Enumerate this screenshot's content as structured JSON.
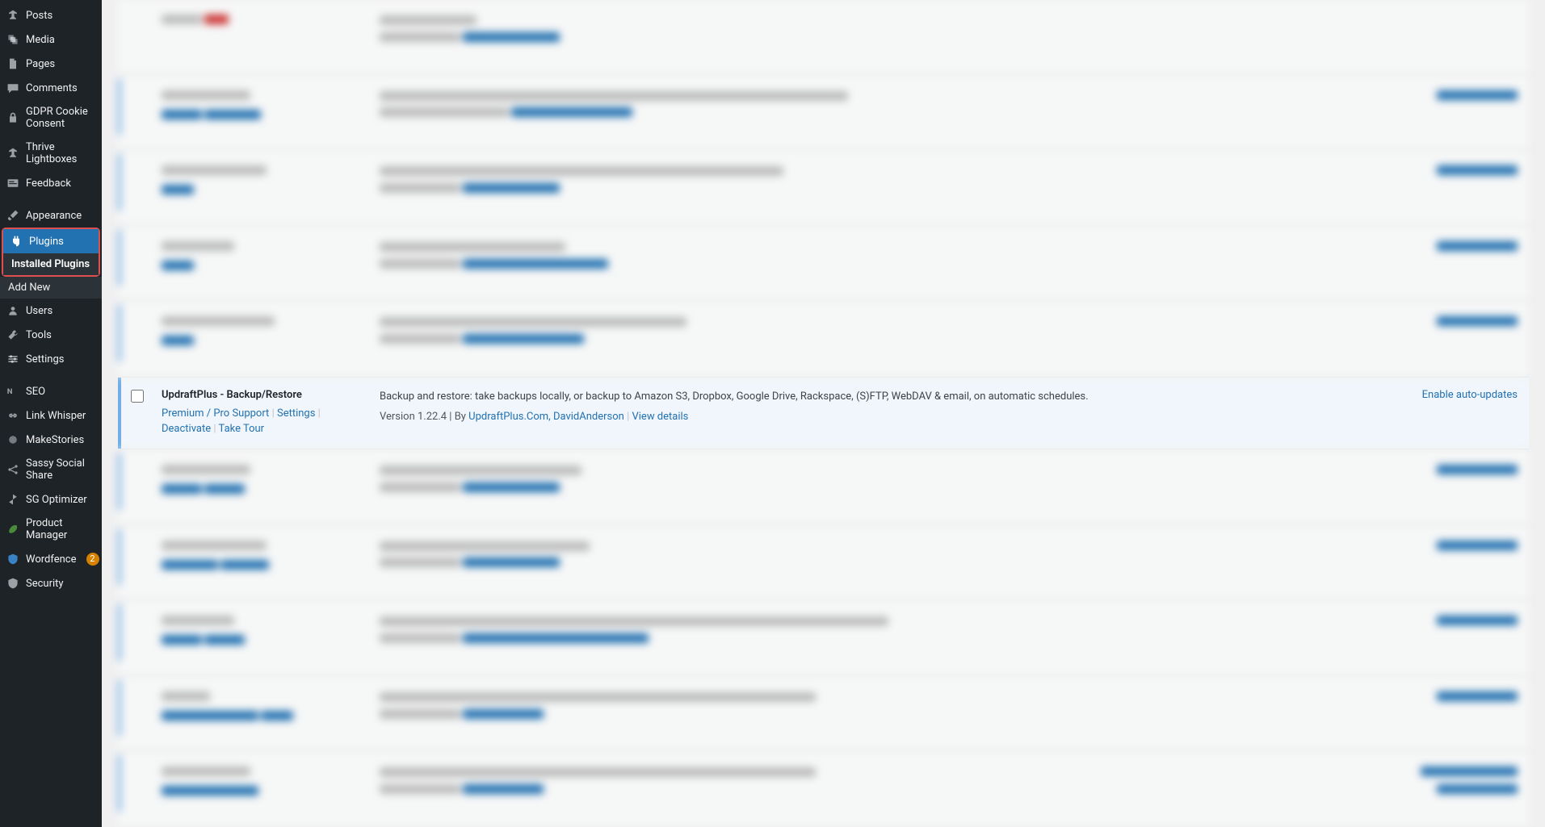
{
  "sidebar": {
    "items": [
      {
        "label": "Posts",
        "icon": "pin-icon"
      },
      {
        "label": "Media",
        "icon": "media-icon"
      },
      {
        "label": "Pages",
        "icon": "page-icon"
      },
      {
        "label": "Comments",
        "icon": "comment-icon"
      },
      {
        "label": "GDPR Cookie Consent",
        "icon": "lock-icon"
      },
      {
        "label": "Thrive Lightboxes",
        "icon": "pin-icon"
      },
      {
        "label": "Feedback",
        "icon": "feedback-icon"
      },
      {
        "label": "Appearance",
        "icon": "brush-icon"
      },
      {
        "label": "Plugins",
        "icon": "plugin-icon",
        "current": true
      },
      {
        "label": "Users",
        "icon": "users-icon"
      },
      {
        "label": "Tools",
        "icon": "tools-icon"
      },
      {
        "label": "Settings",
        "icon": "settings-icon"
      },
      {
        "label": "SEO",
        "icon": "seo-icon"
      },
      {
        "label": "Link Whisper",
        "icon": "link-icon"
      },
      {
        "label": "MakeStories",
        "icon": "stories-icon"
      },
      {
        "label": "Sassy Social Share",
        "icon": "share-icon"
      },
      {
        "label": "SG Optimizer",
        "icon": "optimize-icon"
      },
      {
        "label": "Product Manager",
        "icon": "leaf-icon"
      },
      {
        "label": "Wordfence",
        "icon": "shield-icon",
        "badge": "2"
      },
      {
        "label": "Security",
        "icon": "security-icon"
      }
    ],
    "submenu": {
      "installed": "Installed Plugins",
      "addnew": "Add New"
    }
  },
  "focused_plugin": {
    "name": "UpdraftPlus - Backup/Restore",
    "actions": {
      "premium": "Premium / Pro Support",
      "settings": "Settings",
      "deactivate": "Deactivate",
      "taketour": "Take Tour"
    },
    "description": "Backup and restore: take backups locally, or backup to Amazon S3, Dropbox, Google Drive, Rackspace, (S)FTP, WebDAV & email, on automatic schedules.",
    "version_prefix": "Version 1.22.4 | By ",
    "author": "UpdraftPlus.Com, DavidAnderson",
    "view_details": "View details",
    "auto_update": "Enable auto-updates"
  }
}
